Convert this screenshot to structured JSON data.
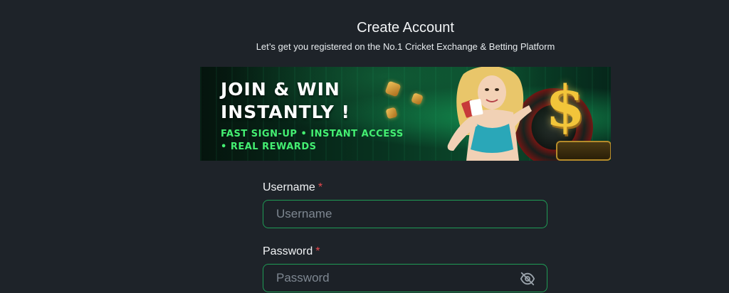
{
  "header": {
    "title": "Create Account",
    "subtitle": "Let’s get you registered on the No.1 Cricket Exchange & Betting Platform"
  },
  "banner": {
    "headline_line1": "JOIN & WIN",
    "headline_line2": "INSTANTLY !",
    "tagline_line1": "FAST SIGN-UP • INSTANT ACCESS",
    "tagline_line2": "• REAL REWARDS",
    "currency_symbol": "$",
    "accent_color": "#44ef72"
  },
  "form": {
    "username": {
      "label": "Username",
      "required_mark": "*",
      "placeholder": "Username",
      "value": ""
    },
    "password": {
      "label": "Password",
      "required_mark": "*",
      "placeholder": "Password",
      "value": "",
      "toggle_icon": "eye-off-icon"
    }
  },
  "colors": {
    "background": "#1e2329",
    "input_border": "#1f9b55",
    "required": "#e5484d",
    "placeholder": "#7e8791"
  }
}
